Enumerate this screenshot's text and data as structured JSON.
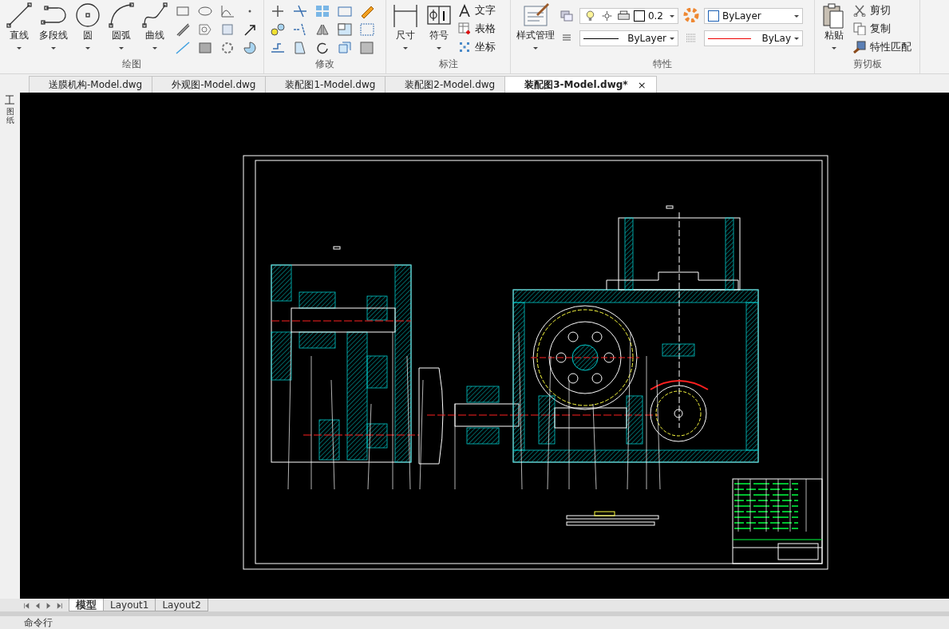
{
  "ribbon": {
    "groups": [
      {
        "label": "绘图",
        "kind": "draw",
        "large_tools": [
          {
            "label": "直线"
          },
          {
            "label": "多段线"
          },
          {
            "label": "圆"
          },
          {
            "label": "圆弧"
          },
          {
            "label": "曲线"
          }
        ]
      },
      {
        "label": "修改",
        "kind": "modify"
      },
      {
        "label": "标注",
        "kind": "annotate",
        "large_tools": [
          {
            "label": "尺寸"
          },
          {
            "label": "符号"
          }
        ],
        "small_tools": [
          {
            "label": "文字"
          },
          {
            "label": "表格"
          },
          {
            "label": "坐标"
          }
        ]
      },
      {
        "label": "特性",
        "kind": "properties",
        "large_tools": [
          {
            "label": "样式管理"
          }
        ],
        "layer": "0.2",
        "color_name": "ByLayer",
        "linetype": "ByLayer",
        "lineweight": "ByLay"
      },
      {
        "label": "剪切板",
        "kind": "clipboard",
        "large_tools": [
          {
            "label": "粘贴"
          }
        ],
        "small_tools": [
          {
            "label": "剪切"
          },
          {
            "label": "复制"
          },
          {
            "label": "特性匹配"
          }
        ]
      }
    ]
  },
  "side_strip": {
    "label": "图纸"
  },
  "document_tabs": [
    {
      "label": "送膜机构-Model.dwg",
      "selected": false
    },
    {
      "label": "外观图-Model.dwg",
      "selected": false
    },
    {
      "label": "装配图1-Model.dwg",
      "selected": false
    },
    {
      "label": "装配图2-Model.dwg",
      "selected": false
    },
    {
      "label": "装配图3-Model.dwg*",
      "selected": true,
      "close": "×"
    }
  ],
  "layout_tabs": [
    {
      "label": "模型",
      "selected": true
    },
    {
      "label": "Layout1",
      "selected": false
    },
    {
      "label": "Layout2",
      "selected": false
    }
  ],
  "command_line": {
    "label": "命令行"
  }
}
